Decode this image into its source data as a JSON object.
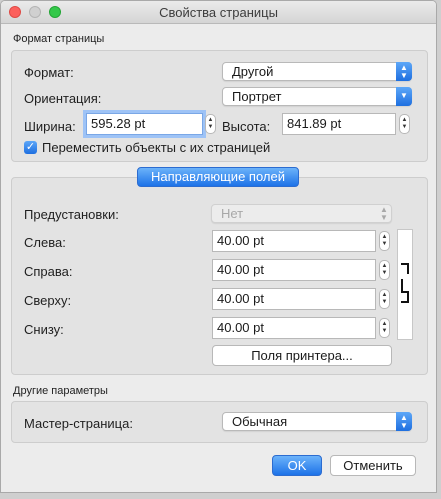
{
  "window": {
    "title": "Свойства страницы"
  },
  "page_format": {
    "section_label": "Формат страницы",
    "format_label": "Формат:",
    "format_value": "Другой",
    "orientation_label": "Ориентация:",
    "orientation_value": "Портрет",
    "width_label": "Ширина:",
    "width_value": "595.28  pt",
    "height_label": "Высота:",
    "height_value": "841.89  pt",
    "move_objects_label": "Переместить объекты с их страницей",
    "move_objects_checked": true
  },
  "margins": {
    "tab_label": "Направляющие полей",
    "presets_label": "Предустановки:",
    "presets_value": "Нет",
    "left_label": "Слева:",
    "left_value": "40.00  pt",
    "right_label": "Справа:",
    "right_value": "40.00  pt",
    "top_label": "Сверху:",
    "top_value": "40.00  pt",
    "bottom_label": "Снизу:",
    "bottom_value": "40.00  pt",
    "printer_margins_button": "Поля принтера..."
  },
  "other": {
    "section_label": "Другие параметры",
    "master_page_label": "Мастер-страница:",
    "master_page_value": "Обычная"
  },
  "buttons": {
    "ok": "OK",
    "cancel": "Отменить"
  },
  "colors": {
    "accent": "#1d72e8",
    "focus_ring": "#9ec3f6",
    "window_bg": "#ececec"
  }
}
